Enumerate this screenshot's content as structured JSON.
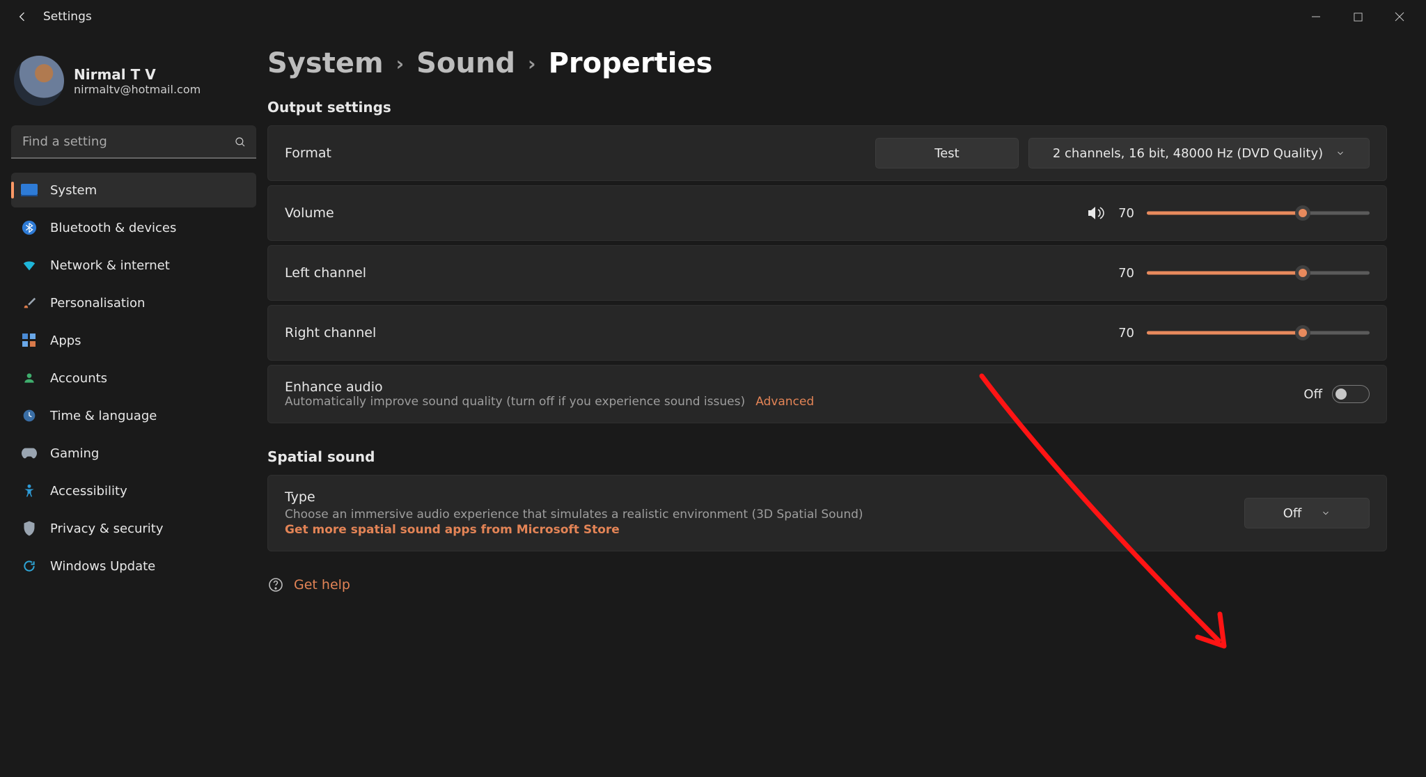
{
  "app_title": "Settings",
  "colors": {
    "accent": "#e88a5d",
    "accent_fill": "#e38456"
  },
  "profile": {
    "name": "Nirmal T V",
    "email": "nirmaltv@hotmail.com"
  },
  "search": {
    "placeholder": "Find a setting"
  },
  "nav": [
    {
      "label": "System",
      "active": true
    },
    {
      "label": "Bluetooth & devices"
    },
    {
      "label": "Network & internet"
    },
    {
      "label": "Personalisation"
    },
    {
      "label": "Apps"
    },
    {
      "label": "Accounts"
    },
    {
      "label": "Time & language"
    },
    {
      "label": "Gaming"
    },
    {
      "label": "Accessibility"
    },
    {
      "label": "Privacy & security"
    },
    {
      "label": "Windows Update"
    }
  ],
  "breadcrumb": {
    "level1": "System",
    "level2": "Sound",
    "current": "Properties"
  },
  "output": {
    "section_title": "Output settings",
    "format": {
      "label": "Format",
      "test_label": "Test",
      "selected": "2 channels, 16 bit, 48000 Hz (DVD Quality)"
    },
    "volume": {
      "label": "Volume",
      "value": "70",
      "percent": 70
    },
    "left": {
      "label": "Left channel",
      "value": "70",
      "percent": 70
    },
    "right": {
      "label": "Right channel",
      "value": "70",
      "percent": 70
    },
    "enhance": {
      "label": "Enhance audio",
      "sub": "Automatically improve sound quality (turn off if you experience sound issues)",
      "advanced": "Advanced",
      "state_label": "Off",
      "on": false
    }
  },
  "spatial": {
    "section_title": "Spatial sound",
    "type": {
      "label": "Type",
      "sub": "Choose an immersive audio experience that simulates a realistic environment (3D Spatial Sound)",
      "store_link": "Get more spatial sound apps from Microsoft Store",
      "selected": "Off"
    }
  },
  "help": {
    "label": "Get help"
  }
}
